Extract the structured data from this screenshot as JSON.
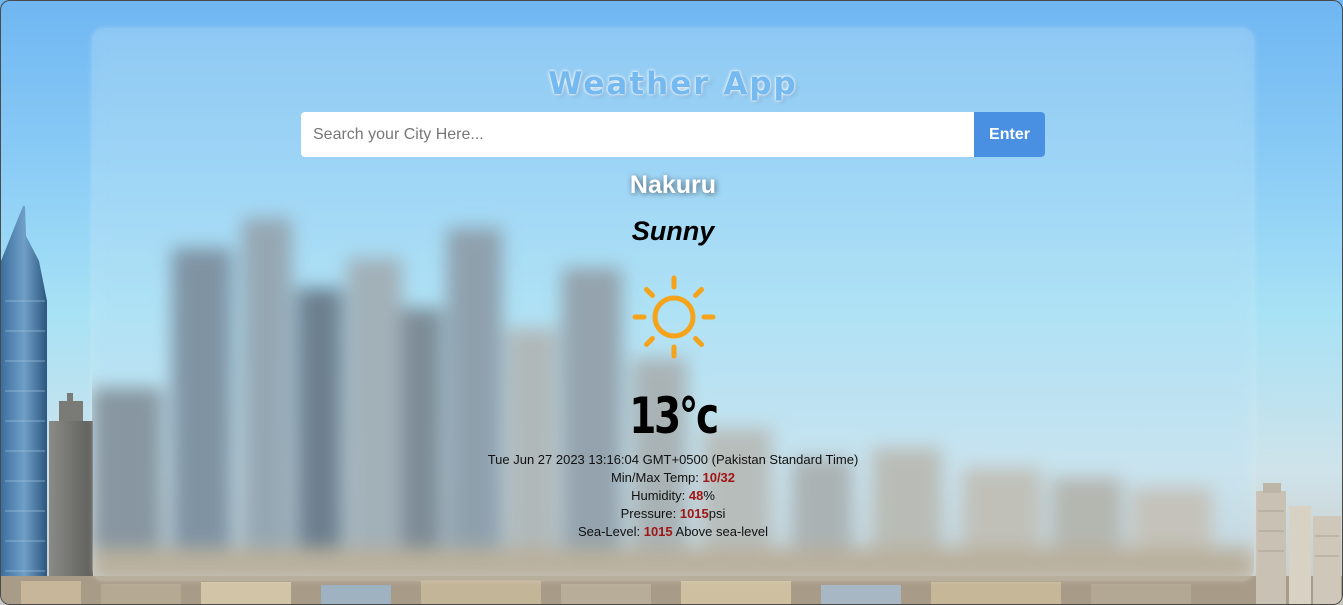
{
  "app": {
    "title": "Weather App"
  },
  "search": {
    "placeholder": "Search your City Here...",
    "value": "",
    "button_label": "Enter"
  },
  "weather": {
    "city": "Nakuru",
    "condition": "Sunny",
    "icon": "sun-icon",
    "temperature": "13°c",
    "datetime": "Tue Jun 27 2023 13:16:04 GMT+0500 (Pakistan Standard Time)",
    "minmax_label": "Min/Max Temp: ",
    "minmax_value": "10/32",
    "humidity_label": "Humidity: ",
    "humidity_value": "48",
    "humidity_unit": "%",
    "pressure_label": "Pressure: ",
    "pressure_value": "1015",
    "pressure_unit": "psi",
    "sealevel_label": "Sea-Level: ",
    "sealevel_value": "1015",
    "sealevel_unit": " Above sea-level"
  },
  "colors": {
    "accent": "#4a90e2",
    "title": "#74b9f0",
    "value_highlight": "#a01616",
    "sun": "#f5a31a"
  }
}
